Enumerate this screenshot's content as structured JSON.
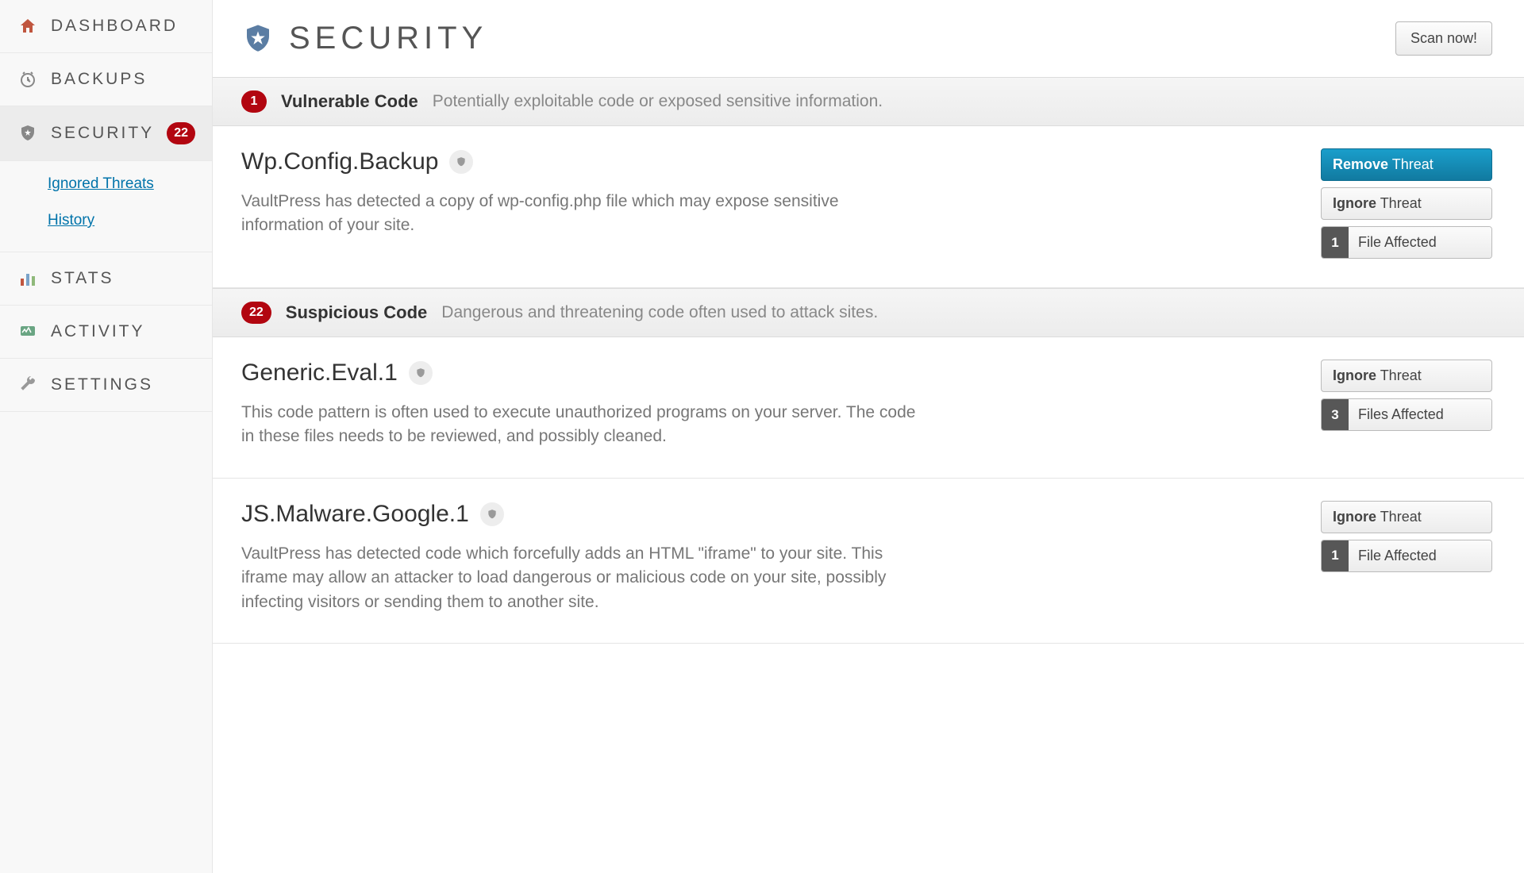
{
  "sidebar": {
    "items": [
      {
        "label": "DASHBOARD",
        "icon": "home"
      },
      {
        "label": "BACKUPS",
        "icon": "clock"
      },
      {
        "label": "SECURITY",
        "icon": "shield",
        "badge": "22",
        "active": true,
        "children": [
          {
            "label": "Ignored Threats"
          },
          {
            "label": "History"
          }
        ]
      },
      {
        "label": "STATS",
        "icon": "bars"
      },
      {
        "label": "ACTIVITY",
        "icon": "monitor"
      },
      {
        "label": "SETTINGS",
        "icon": "wrench"
      }
    ]
  },
  "page": {
    "title": "SECURITY",
    "scan_button": "Scan now!"
  },
  "sections": [
    {
      "count": "1",
      "title": "Vulnerable Code",
      "desc": "Potentially exploitable code or exposed sensitive information.",
      "threats": [
        {
          "name": "Wp.Config.Backup",
          "desc": "VaultPress has detected a copy of wp-config.php file which may expose sensitive information of your site.",
          "remove_strong": "Remove",
          "remove_rest": " Threat",
          "ignore_strong": "Ignore",
          "ignore_rest": " Threat",
          "files_count": "1",
          "files_label": "File Affected",
          "has_remove": true
        }
      ]
    },
    {
      "count": "22",
      "title": "Suspicious Code",
      "desc": "Dangerous and threatening code often used to attack sites.",
      "threats": [
        {
          "name": "Generic.Eval.1",
          "desc": "This code pattern is often used to execute unauthorized programs on your server. The code in these files needs to be reviewed, and possibly cleaned.",
          "ignore_strong": "Ignore",
          "ignore_rest": " Threat",
          "files_count": "3",
          "files_label": "Files Affected",
          "has_remove": false
        },
        {
          "name": "JS.Malware.Google.1",
          "desc": "VaultPress has detected code which forcefully adds an HTML \"iframe\" to your site. This iframe may allow an attacker to load dangerous or malicious code on your site, possibly infecting visitors or sending them to another site.",
          "ignore_strong": "Ignore",
          "ignore_rest": " Threat",
          "files_count": "1",
          "files_label": "File Affected",
          "has_remove": false
        }
      ]
    }
  ]
}
